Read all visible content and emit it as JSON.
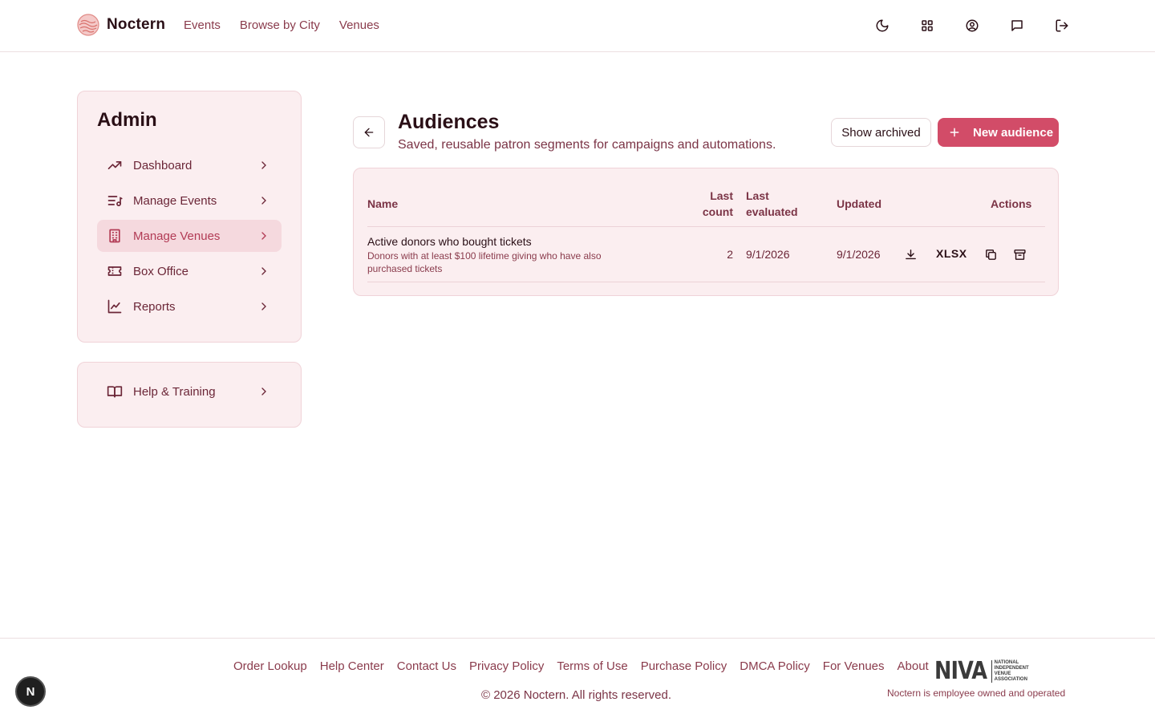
{
  "header": {
    "brand": "Noctern",
    "nav": [
      "Events",
      "Browse by City",
      "Venues"
    ],
    "icons": [
      "moon-icon",
      "grid-icon",
      "account-icon",
      "chat-icon",
      "logout-icon"
    ]
  },
  "sidebar": {
    "title": "Admin",
    "items": [
      {
        "label": "Dashboard",
        "icon": "trending-up-icon"
      },
      {
        "label": "Manage Events",
        "icon": "list-music-icon"
      },
      {
        "label": "Manage Venues",
        "icon": "building-icon",
        "active": true
      },
      {
        "label": "Box Office",
        "icon": "ticket-icon"
      },
      {
        "label": "Reports",
        "icon": "chart-line-icon"
      }
    ],
    "help": {
      "label": "Help & Training",
      "icon": "book-icon"
    }
  },
  "main": {
    "title": "Audiences",
    "subtitle": "Saved, reusable patron segments for campaigns and automations.",
    "show_archived": "Show archived",
    "new_audience": "New audience",
    "table": {
      "headers": {
        "name": "Name",
        "last_count_1": "Last",
        "last_count_2": "count",
        "last_eval_1": "Last",
        "last_eval_2": "evaluated",
        "updated": "Updated",
        "actions": "Actions"
      },
      "rows": [
        {
          "name": "Active donors who bought tickets",
          "description": "Donors with at least $100 lifetime giving who have also purchased tickets",
          "last_count": "2",
          "last_evaluated": "9/1/2026",
          "updated": "9/1/2026",
          "export_label": "XLSX"
        }
      ]
    }
  },
  "footer": {
    "links": [
      "Order Lookup",
      "Help Center",
      "Contact Us",
      "Privacy Policy",
      "Terms of Use",
      "Purchase Policy",
      "DMCA Policy",
      "For Venues",
      "About"
    ],
    "copyright": "© 2026 Noctern. All rights reserved.",
    "niva_logo": "NIVA",
    "niva_tagline": "NATIONAL INDEPENDENT VENUE ASSOCIATION",
    "employee_note": "Noctern is employee owned and operated"
  },
  "dev_badge": "N",
  "colors": {
    "accent": "#d24c68",
    "card_bg": "#fbeef0",
    "active_bg": "#f5d9de",
    "link": "#8a3b4c"
  }
}
